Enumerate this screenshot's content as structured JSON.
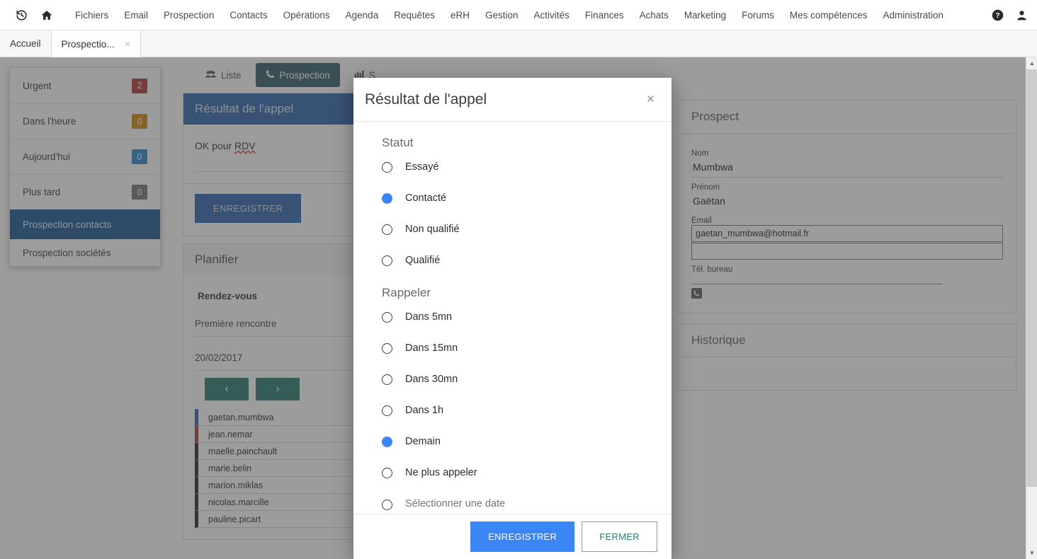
{
  "navbar": {
    "icons": [
      {
        "name": "history-icon",
        "glyph": "↺"
      },
      {
        "name": "home-icon",
        "glyph": "⌂"
      }
    ],
    "links": [
      "Fichiers",
      "Email",
      "Prospection",
      "Contacts",
      "Opérations",
      "Agenda",
      "Requêtes",
      "eRH",
      "Gestion",
      "Activités",
      "Finances",
      "Achats",
      "Marketing",
      "Forums",
      "Mes compétences",
      "Administration"
    ],
    "help_icon": "help-icon",
    "user_icon": "user-icon"
  },
  "tabstrip": {
    "tabs": [
      {
        "label": "Accueil",
        "active": false,
        "closable": false
      },
      {
        "label": "Prospectio...",
        "active": true,
        "closable": true
      }
    ],
    "close_glyph": "×"
  },
  "menu_panel": {
    "items": [
      {
        "label": "Urgent",
        "badge": "2",
        "badge_color": "red",
        "selected": false
      },
      {
        "label": "Dans l'heure",
        "badge": "0",
        "badge_color": "orange",
        "selected": false
      },
      {
        "label": "Aujourd'hui",
        "badge": "0",
        "badge_color": "blue",
        "selected": false
      },
      {
        "label": "Plus tard",
        "badge": "0",
        "badge_color": "grey",
        "selected": false
      },
      {
        "label": "Prospection contacts",
        "badge": "",
        "badge_color": "",
        "selected": true
      },
      {
        "label": "Prospection sociétés",
        "badge": "",
        "badge_color": "",
        "selected": false
      }
    ]
  },
  "content_tabs": [
    {
      "label": "Liste",
      "icon": "group-icon",
      "glyph": "👥",
      "active": false
    },
    {
      "label": "Prospection",
      "icon": "phone-icon",
      "glyph": "☎",
      "active": true
    },
    {
      "label": "S",
      "icon": "chart-icon",
      "glyph": "📊",
      "active": false
    }
  ],
  "call_result_panel": {
    "title": "Résultat de l'appel",
    "note_prefix": "OK pour ",
    "note_spelled": "RDV",
    "save_label": "ENREGISTRER"
  },
  "plan_panel": {
    "title": "Planifier",
    "type_label": "Rendez-vous",
    "subject": "Première rencontre",
    "date": "20/02/2017",
    "prev_glyph": "‹",
    "next_glyph": "›"
  },
  "contact_list": [
    {
      "login": "gaetan.mumbwa",
      "bar": "#1f5ba8"
    },
    {
      "login": "jean.nemar",
      "bar": "#a92f2a"
    },
    {
      "login": "maelle.painchault",
      "bar": "#1c1c1c"
    },
    {
      "login": "marie.belin",
      "bar": "#1c1c1c"
    },
    {
      "login": "marion.miklas",
      "bar": "#1c1c1c"
    },
    {
      "login": "nicolas.marcille",
      "bar": "#1c1c1c"
    },
    {
      "login": "pauline.picart",
      "bar": "#1c1c1c"
    }
  ],
  "prospect_panel": {
    "title": "Prospect",
    "nom_label": "Nom",
    "nom_value": "Mumbwa",
    "prenom_label": "Prénom",
    "prenom_value": "Gaëtan",
    "email_label": "Email",
    "email_value": "gaetan_mumbwa@hotmail.fr",
    "email2_value": "",
    "tel_label": "Tél. bureau",
    "phone_glyph": "☎"
  },
  "history_panel": {
    "title": "Historique"
  },
  "modal": {
    "title": "Résultat de l'appel",
    "close_glyph": "×",
    "statut_group": "Statut",
    "statut_options": [
      {
        "label": "Essayé",
        "checked": false
      },
      {
        "label": "Contacté",
        "checked": true
      },
      {
        "label": "Non qualifié",
        "checked": false
      },
      {
        "label": "Qualifié",
        "checked": false
      }
    ],
    "rappeler_group": "Rappeler",
    "rappeler_options": [
      {
        "label": "Dans 5mn",
        "checked": false
      },
      {
        "label": "Dans 15mn",
        "checked": false
      },
      {
        "label": "Dans 30mn",
        "checked": false
      },
      {
        "label": "Dans 1h",
        "checked": false
      },
      {
        "label": "Demain",
        "checked": true
      },
      {
        "label": "Ne plus appeler",
        "checked": false
      }
    ],
    "date_option_checked": false,
    "date_placeholder": "Sélectionner une date",
    "date_value": "",
    "save_label": "ENREGISTRER",
    "close_label": "FERMER"
  },
  "scrollbar": {
    "up_glyph": "▲",
    "down_glyph": "▼"
  },
  "colors": {
    "accent_blue": "#3b86f7",
    "panel_blue": "#1f5ba8",
    "teal": "#3fbfa4",
    "menu_selected": "#0b4c87"
  }
}
